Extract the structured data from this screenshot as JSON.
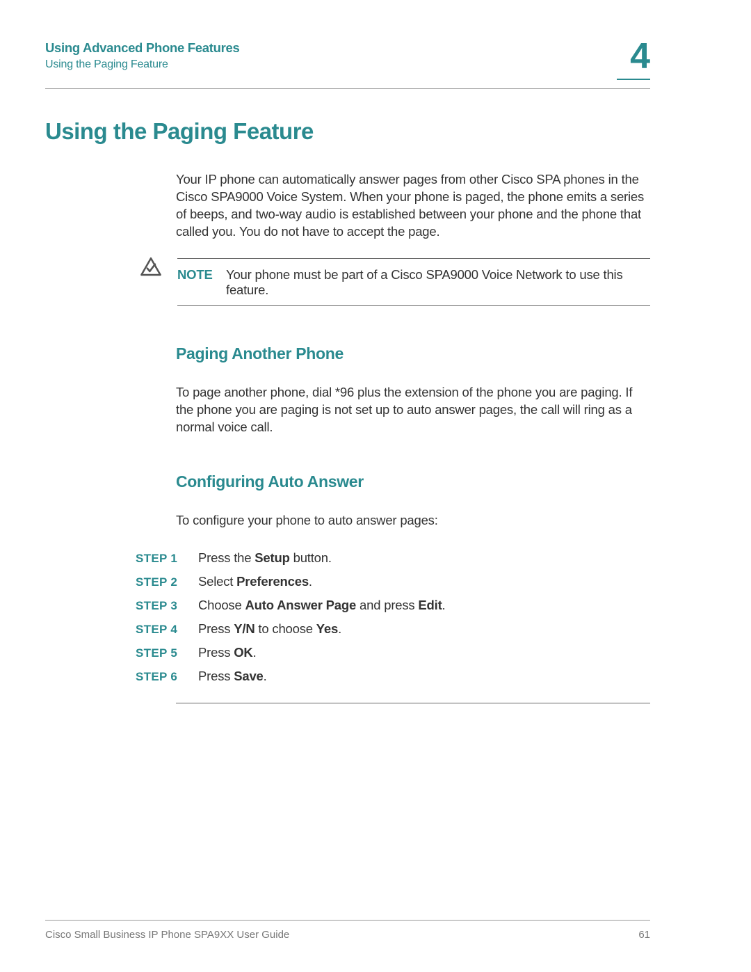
{
  "colors": {
    "accent": "#2a8a8f"
  },
  "header": {
    "title": "Using Advanced Phone Features",
    "subtitle": "Using the Paging Feature",
    "chapter": "4"
  },
  "section": {
    "title": "Using the Paging Feature",
    "intro": "Your IP phone can automatically answer pages from other Cisco SPA phones in the Cisco SPA9000 Voice System. When your phone is paged, the phone emits a series of beeps, and two-way audio is established between your phone and the phone that called you. You do not have to accept the page."
  },
  "note": {
    "label": "NOTE",
    "text": "Your phone must be part of a Cisco SPA9000 Voice Network to use this feature."
  },
  "sub1": {
    "title": "Paging Another Phone",
    "text": "To page another phone, dial *96 plus the extension of the phone you are paging. If the phone you are paging is not set up to auto answer pages, the call will ring as a normal voice call."
  },
  "sub2": {
    "title": "Configuring Auto Answer",
    "intro": "To configure your phone to auto answer pages:"
  },
  "steps": [
    {
      "label": "STEP 1",
      "parts": [
        "Press the ",
        "Setup",
        " button."
      ]
    },
    {
      "label": "STEP 2",
      "parts": [
        "Select ",
        "Preferences",
        "."
      ]
    },
    {
      "label": "STEP 3",
      "parts": [
        "Choose ",
        "Auto Answer Page",
        " and press ",
        "Edit",
        "."
      ]
    },
    {
      "label": "STEP 4",
      "parts": [
        "Press ",
        "Y/N",
        " to choose ",
        "Yes",
        "."
      ]
    },
    {
      "label": "STEP 5",
      "parts": [
        "Press ",
        "OK",
        "."
      ]
    },
    {
      "label": "STEP 6",
      "parts": [
        "Press ",
        "Save",
        "."
      ]
    }
  ],
  "footer": {
    "guide": "Cisco Small Business IP Phone SPA9XX User Guide",
    "page": "61"
  }
}
